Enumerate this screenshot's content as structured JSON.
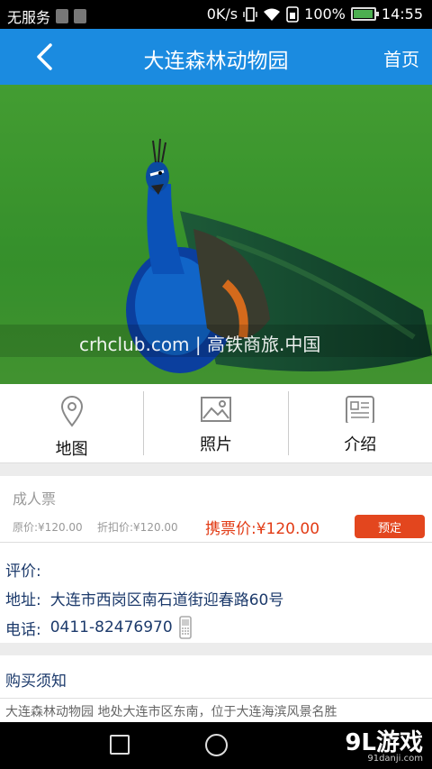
{
  "status_bar": {
    "carrier": "无服务",
    "net_speed": "0K/s",
    "battery": "100%",
    "time": "14:55"
  },
  "header": {
    "title": "大连森林动物园",
    "home_label": "首页"
  },
  "hero": {
    "watermark": "crhclub.com | 高铁商旅.中国"
  },
  "tabs": [
    {
      "label": "地图",
      "icon": "map-pin-icon"
    },
    {
      "label": "照片",
      "icon": "photo-icon"
    },
    {
      "label": "介绍",
      "icon": "document-icon"
    }
  ],
  "ticket": {
    "name": "成人票",
    "original_price": "原价:¥120.00",
    "discount_price": "折扣价:¥120.00",
    "price": "携票价:¥120.00",
    "book_label": "预定"
  },
  "info": {
    "rating_label": "评价:",
    "address_label": "地址:",
    "address": "大连市西岗区南石道街迎春路60号",
    "phone_label": "电话:",
    "phone": "0411-82476970"
  },
  "notice": {
    "title": "购买须知",
    "text": "大连森林动物园 地处大连市区东南，位于大连海滨风景名胜"
  },
  "brand": {
    "main": "9L游戏",
    "sub": "91danji.com"
  },
  "colors": {
    "header": "#1b8be0",
    "accent": "#e3461e",
    "price": "#e23c16"
  }
}
